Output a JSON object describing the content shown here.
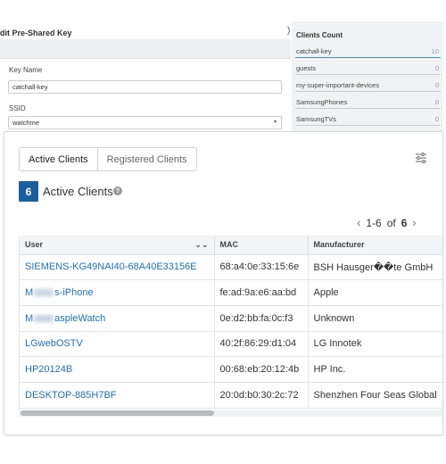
{
  "edit_panel": {
    "title": "dit Pre-Shared Key",
    "key_name_label": "Key Name",
    "key_name_value": "catchall-key",
    "ssid_label": "SSID",
    "ssid_value": "watchme",
    "paren": ")"
  },
  "clients_count": {
    "title": "Clients Count",
    "items": [
      {
        "name": "catchall-key",
        "count": "10",
        "fraction": 1.0
      },
      {
        "name": "guests",
        "count": "0",
        "fraction": 0
      },
      {
        "name": "my-super-important-devices",
        "count": "0",
        "fraction": 0
      },
      {
        "name": "SamsungPhones",
        "count": "0",
        "fraction": 0
      },
      {
        "name": "SamsungTVs",
        "count": "0",
        "fraction": 0
      }
    ]
  },
  "tabs": {
    "active": "Active Clients",
    "registered": "Registered Clients"
  },
  "summary": {
    "count": "6",
    "label": "Active Clients",
    "help": "?"
  },
  "pagination": {
    "range": "1-6",
    "of": "of",
    "total": "6",
    "prev": "‹",
    "next": "›"
  },
  "table": {
    "columns": [
      "User",
      "MAC",
      "Manufacturer"
    ],
    "sort_icon": "chevron-double-down-icon",
    "rows": [
      {
        "user_pre": "SIEMENS-KG49NAI40-68A40E33156E",
        "user_post": "",
        "mac": "68:a4:0e:33:15:6e",
        "manufacturer": "BSH Hausger��te GmbH"
      },
      {
        "user_pre": "M",
        "user_post": "s-iPhone",
        "mac": "fe:ad:9a:e6:aa:bd",
        "manufacturer": "Apple"
      },
      {
        "user_pre": "M",
        "user_post": "aspleWatch",
        "mac": "0e:d2:bb:fa:0c:f3",
        "manufacturer": "Unknown"
      },
      {
        "user_pre": "LGwebOSTV",
        "user_post": "",
        "mac": "40:2f:86:29:d1:04",
        "manufacturer": "LG Innotek"
      },
      {
        "user_pre": "HP20124B",
        "user_post": "",
        "mac": "00:68:eb:20:12:4b",
        "manufacturer": "HP Inc."
      },
      {
        "user_pre": "DESKTOP-885H7BF",
        "user_post": "",
        "mac": "20:0d:b0:30:2c:72",
        "manufacturer": "Shenzhen Four Seas Global"
      }
    ]
  },
  "colors": {
    "accent": "#1c5fa0",
    "link": "#1f6fb8",
    "bar_fill": "#3d8fd9"
  }
}
